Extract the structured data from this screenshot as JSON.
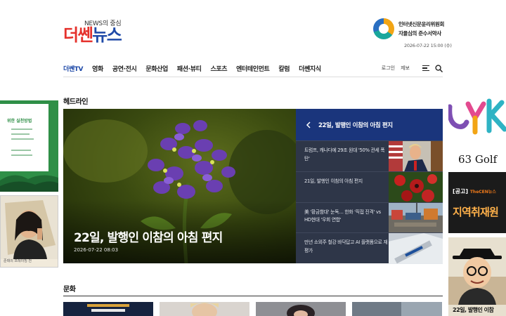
{
  "header": {
    "logo_tag": "NEWS의 중심",
    "logo_part1": "더쎈",
    "logo_part2": "뉴스",
    "ethics_line1": "인터넷신문윤리위원회",
    "ethics_line2": "자율심의 준수서약사",
    "date": "2026-07-22 15:00 (수)"
  },
  "nav": {
    "items": [
      {
        "label": "더쎈TV",
        "active": true
      },
      {
        "label": "영화"
      },
      {
        "label": "공연·전시"
      },
      {
        "label": "문화산업"
      },
      {
        "label": "패션·뷰티"
      },
      {
        "label": "스포츠"
      },
      {
        "label": "엔터테인먼트"
      },
      {
        "label": "칼럼"
      },
      {
        "label": "더쎈지식"
      }
    ],
    "login": "로그인",
    "report": "제보"
  },
  "headline": {
    "section_title": "헤드라인",
    "main_title": "22일, 발행인 이참의 아침 편지",
    "main_date": "2026-07-22 08:03",
    "side_title": "22일, 발행인 이참의 아침 편지",
    "side_items": [
      {
        "text": "트럼프, 캐나다에 29조 원대 '50% 관세 폭탄'",
        "thumb": "trump"
      },
      {
        "text": "21일, 발행인 이참의 아침 편지",
        "thumb": "flowers"
      },
      {
        "text": "美 '황금함대' 눈독… 한화 '직접 진격' vs HD현대 '우회 연합'",
        "thumb": "shipyard"
      },
      {
        "text": "만년 소외주 철강 바닥답고 AI 플랫폼으로 재평가",
        "thumb": "posco"
      }
    ]
  },
  "culture": {
    "section_title": "문화"
  },
  "ads": {
    "left_top_title": "위한 실천방법",
    "left_bottom_caption": "준태의 프레이밍 전",
    "right_top_text": "63 Golf",
    "right_mid_notice": "[공고]",
    "right_mid_brand": "TheCEN뉴스",
    "right_mid_big": "지역취재원",
    "right_bottom_caption": "22일, 발행인 이참"
  },
  "colors": {
    "brand_red": "#e5322d",
    "brand_blue": "#1f4aa8",
    "panel_bg": "#2e3648",
    "panel_head": "#1a357c"
  }
}
